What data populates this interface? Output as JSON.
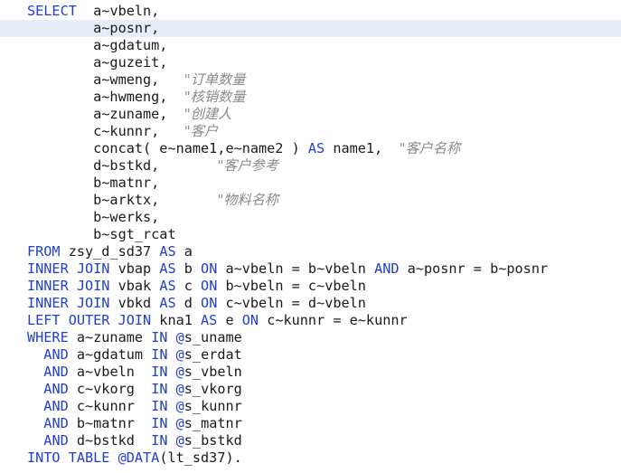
{
  "colors": {
    "keyword": "#1f3fcf",
    "text": "#1a1a1a",
    "comment": "#8a8a8a",
    "current_line": "#e8eef9",
    "background": "#ffffff"
  },
  "lines": [
    {
      "segments": [
        {
          "t": "kw",
          "v": "SELECT"
        },
        {
          "t": "id",
          "v": "  a~vbeln,"
        }
      ]
    },
    {
      "segments": [
        {
          "t": "id",
          "v": "        a~posnr,"
        }
      ]
    },
    {
      "segments": [
        {
          "t": "id",
          "v": "        a~gdatum,"
        }
      ]
    },
    {
      "segments": [
        {
          "t": "id",
          "v": "        a~guzeit,"
        }
      ]
    },
    {
      "segments": [
        {
          "t": "id",
          "v": "        a~wmeng,   "
        },
        {
          "t": "cm",
          "v": "\"订单数量"
        }
      ]
    },
    {
      "segments": [
        {
          "t": "id",
          "v": "        a~hwmeng,  "
        },
        {
          "t": "cm",
          "v": "\"核销数量"
        }
      ]
    },
    {
      "segments": [
        {
          "t": "id",
          "v": "        a~zuname,  "
        },
        {
          "t": "cm",
          "v": "\"创建人"
        }
      ]
    },
    {
      "segments": [
        {
          "t": "id",
          "v": "        c~kunnr,   "
        },
        {
          "t": "cm",
          "v": "\"客户"
        }
      ]
    },
    {
      "segments": [
        {
          "t": "id",
          "v": "        concat( e~name1,e~name2 ) "
        },
        {
          "t": "kw",
          "v": "AS"
        },
        {
          "t": "id",
          "v": " name1,  "
        },
        {
          "t": "cm",
          "v": "\"客户名称"
        }
      ]
    },
    {
      "segments": [
        {
          "t": "id",
          "v": "        d~bstkd,       "
        },
        {
          "t": "cm",
          "v": "\"客户参考"
        }
      ]
    },
    {
      "segments": [
        {
          "t": "id",
          "v": "        b~matnr,"
        }
      ]
    },
    {
      "segments": [
        {
          "t": "id",
          "v": "        b~arktx,       "
        },
        {
          "t": "cm",
          "v": "\"物料名称"
        }
      ]
    },
    {
      "segments": [
        {
          "t": "id",
          "v": "        b~werks,"
        }
      ]
    },
    {
      "segments": [
        {
          "t": "id",
          "v": "        b~sgt_rcat"
        }
      ]
    },
    {
      "segments": [
        {
          "t": "kw",
          "v": "FROM"
        },
        {
          "t": "id",
          "v": " zsy_d_sd37 "
        },
        {
          "t": "kw",
          "v": "AS"
        },
        {
          "t": "id",
          "v": " a"
        }
      ]
    },
    {
      "segments": [
        {
          "t": "kw",
          "v": "INNER JOIN"
        },
        {
          "t": "id",
          "v": " vbap "
        },
        {
          "t": "kw",
          "v": "AS"
        },
        {
          "t": "id",
          "v": " b "
        },
        {
          "t": "kw",
          "v": "ON"
        },
        {
          "t": "id",
          "v": " a~vbeln = b~vbeln "
        },
        {
          "t": "kw",
          "v": "AND"
        },
        {
          "t": "id",
          "v": " a~posnr = b~posnr"
        }
      ]
    },
    {
      "segments": [
        {
          "t": "kw",
          "v": "INNER JOIN"
        },
        {
          "t": "id",
          "v": " vbak "
        },
        {
          "t": "kw",
          "v": "AS"
        },
        {
          "t": "id",
          "v": " c "
        },
        {
          "t": "kw",
          "v": "ON"
        },
        {
          "t": "id",
          "v": " b~vbeln = c~vbeln"
        }
      ]
    },
    {
      "segments": [
        {
          "t": "kw",
          "v": "INNER JOIN"
        },
        {
          "t": "id",
          "v": " vbkd "
        },
        {
          "t": "kw",
          "v": "AS"
        },
        {
          "t": "id",
          "v": " d "
        },
        {
          "t": "kw",
          "v": "ON"
        },
        {
          "t": "id",
          "v": " c~vbeln = d~vbeln"
        }
      ]
    },
    {
      "segments": [
        {
          "t": "kw",
          "v": "LEFT OUTER JOIN"
        },
        {
          "t": "id",
          "v": " kna1 "
        },
        {
          "t": "kw",
          "v": "AS"
        },
        {
          "t": "id",
          "v": " e "
        },
        {
          "t": "kw",
          "v": "ON"
        },
        {
          "t": "id",
          "v": " c~kunnr = e~kunnr"
        }
      ]
    },
    {
      "segments": [
        {
          "t": "kw",
          "v": "WHERE"
        },
        {
          "t": "id",
          "v": " a~zuname "
        },
        {
          "t": "kw",
          "v": "IN"
        },
        {
          "t": "id",
          "v": " "
        },
        {
          "t": "kw",
          "v": "@"
        },
        {
          "t": "id",
          "v": "s_uname"
        }
      ]
    },
    {
      "segments": [
        {
          "t": "id",
          "v": "  "
        },
        {
          "t": "kw",
          "v": "AND"
        },
        {
          "t": "id",
          "v": " a~gdatum "
        },
        {
          "t": "kw",
          "v": "IN"
        },
        {
          "t": "id",
          "v": " "
        },
        {
          "t": "kw",
          "v": "@"
        },
        {
          "t": "id",
          "v": "s_erdat"
        }
      ]
    },
    {
      "segments": [
        {
          "t": "id",
          "v": "  "
        },
        {
          "t": "kw",
          "v": "AND"
        },
        {
          "t": "id",
          "v": " a~vbeln  "
        },
        {
          "t": "kw",
          "v": "IN"
        },
        {
          "t": "id",
          "v": " "
        },
        {
          "t": "kw",
          "v": "@"
        },
        {
          "t": "id",
          "v": "s_vbeln"
        }
      ]
    },
    {
      "segments": [
        {
          "t": "id",
          "v": "  "
        },
        {
          "t": "kw",
          "v": "AND"
        },
        {
          "t": "id",
          "v": " c~vkorg  "
        },
        {
          "t": "kw",
          "v": "IN"
        },
        {
          "t": "id",
          "v": " "
        },
        {
          "t": "kw",
          "v": "@"
        },
        {
          "t": "id",
          "v": "s_vkorg"
        }
      ]
    },
    {
      "segments": [
        {
          "t": "id",
          "v": "  "
        },
        {
          "t": "kw",
          "v": "AND"
        },
        {
          "t": "id",
          "v": " c~kunnr  "
        },
        {
          "t": "kw",
          "v": "IN"
        },
        {
          "t": "id",
          "v": " "
        },
        {
          "t": "kw",
          "v": "@"
        },
        {
          "t": "id",
          "v": "s_kunnr"
        }
      ]
    },
    {
      "segments": [
        {
          "t": "id",
          "v": "  "
        },
        {
          "t": "kw",
          "v": "AND"
        },
        {
          "t": "id",
          "v": " b~matnr  "
        },
        {
          "t": "kw",
          "v": "IN"
        },
        {
          "t": "id",
          "v": " "
        },
        {
          "t": "kw",
          "v": "@"
        },
        {
          "t": "id",
          "v": "s_matnr"
        }
      ]
    },
    {
      "segments": [
        {
          "t": "id",
          "v": "  "
        },
        {
          "t": "kw",
          "v": "AND"
        },
        {
          "t": "id",
          "v": " d~bstkd  "
        },
        {
          "t": "kw",
          "v": "IN"
        },
        {
          "t": "id",
          "v": " "
        },
        {
          "t": "kw",
          "v": "@"
        },
        {
          "t": "id",
          "v": "s_bstkd"
        }
      ]
    },
    {
      "segments": [
        {
          "t": "kw",
          "v": "INTO TABLE"
        },
        {
          "t": "id",
          "v": " "
        },
        {
          "t": "kw",
          "v": "@DATA"
        },
        {
          "t": "id",
          "v": "(lt_sd37)."
        }
      ]
    }
  ],
  "current_line": 2
}
